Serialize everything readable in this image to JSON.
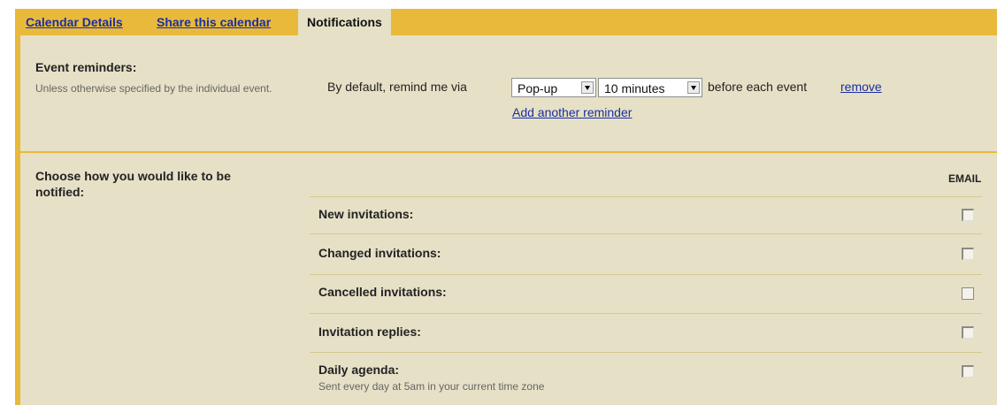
{
  "tabs": [
    {
      "label": "Calendar Details"
    },
    {
      "label": "Share this calendar"
    },
    {
      "label": "Notifications"
    }
  ],
  "reminders": {
    "title": "Event reminders:",
    "subtitle": "Unless otherwise specified by the individual event.",
    "default_text": "By default, remind me via",
    "method_value": "Pop-up",
    "time_value": "10 minutes",
    "suffix": "before each event",
    "remove_label": "remove",
    "add_label": "Add another reminder"
  },
  "notify": {
    "title": "Choose how you would like to be notified:",
    "column_header": "EMAIL",
    "rows": [
      {
        "label": "New invitations:"
      },
      {
        "label": "Changed invitations:"
      },
      {
        "label": "Cancelled invitations:"
      },
      {
        "label": "Invitation replies:"
      },
      {
        "label": "Daily agenda:",
        "sub": "Sent every day at 5am in your current time zone"
      }
    ]
  }
}
